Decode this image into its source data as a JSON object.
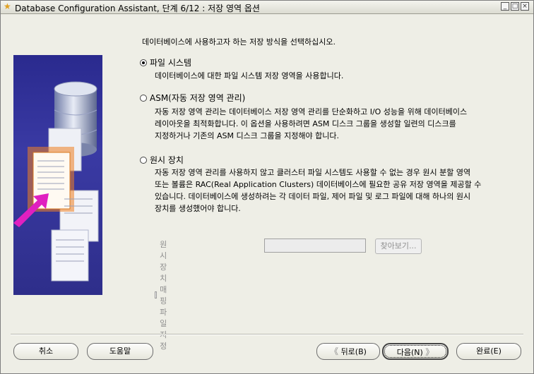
{
  "window": {
    "title": "Database Configuration Assistant, 단계 6/12 : 저장 영역 옵션",
    "minimize": "_",
    "maximize": "□",
    "close": "×"
  },
  "intro": "데이터베이스에 사용하고자 하는 저장 방식을 선택하십시오.",
  "options": [
    {
      "label": "파일 시스템",
      "selected": true,
      "description": [
        "데이터베이스에 대한 파일 시스템 저장 영역을 사용합니다."
      ]
    },
    {
      "label": "ASM(자동 저장 영역 관리)",
      "selected": false,
      "description": [
        "자동 저장 영역 관리는 데이터베이스 저장 영역 관리를 단순화하고 I/O 성능을 위해 데이터베이스",
        "레이아웃을 최적화합니다. 이 옵션을 사용하려면 ASM 디스크 그룹을 생성할 일련의 디스크를",
        "지정하거나 기존의 ASM 디스크 그룹을 지정해야 합니다."
      ]
    },
    {
      "label": "원시 장치",
      "selected": false,
      "description": [
        "자동 저장 영역 관리를 사용하지 않고 클러스터 파일 시스템도 사용할 수 없는 경우 원시 분할 영역",
        "또는 볼륨은 RAC(Real Application Clusters) 데이터베이스에 필요한 공유 저장 영역을 제공할 수",
        "있습니다. 데이터베이스에 생성하려는 각 데이터 파일, 제어 파일 및 로그 파일에 대해 하나의 원시",
        "장치를 생성했어야 합니다."
      ]
    }
  ],
  "mapping": {
    "label": "원시 장치 매핑 파일 지정",
    "value": "",
    "browse": "찾아보기..."
  },
  "buttons": {
    "cancel": "취소",
    "help": "도움말",
    "back": "뒤로(B)",
    "next": "다음(N)",
    "finish": "완료(E)"
  },
  "icons": {
    "window": "app-star-icon",
    "back": "chevron-left-icon",
    "next": "chevron-right-icon"
  },
  "colors": {
    "art_background": "#2a2a8e",
    "arrow": "#e020c0",
    "highlight": "#f08020"
  }
}
